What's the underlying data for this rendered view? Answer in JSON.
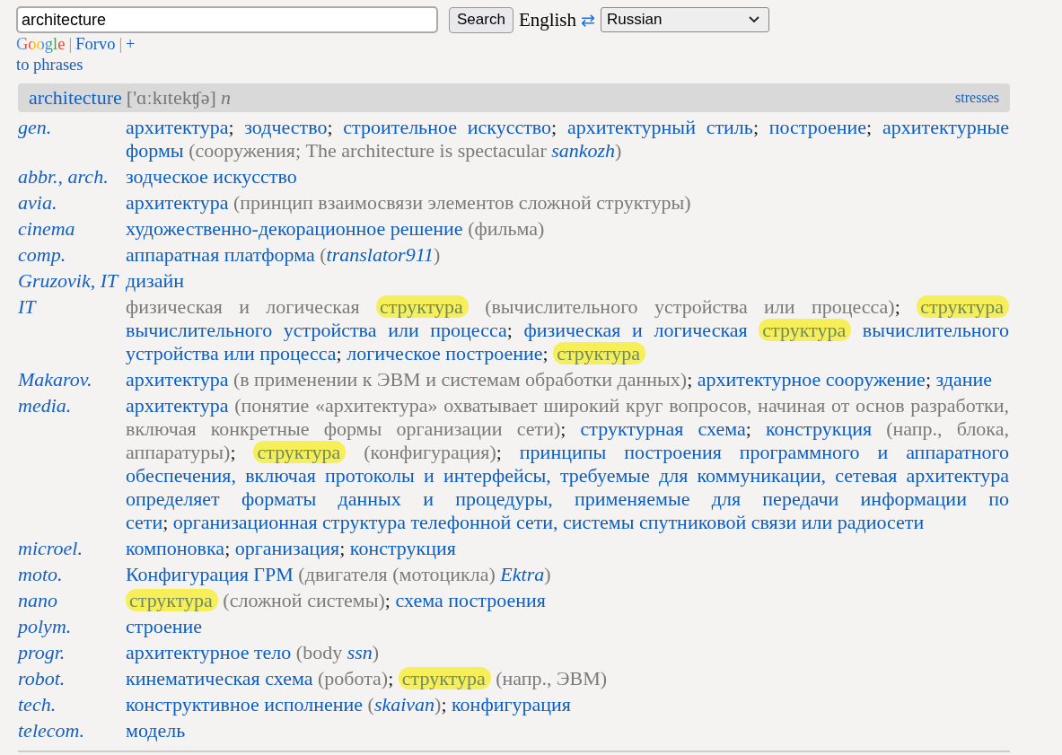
{
  "search": {
    "value": "architecture"
  },
  "search_button": "Search",
  "source_language": "English",
  "swap_icon": "⇄",
  "target_language": "Russian",
  "links": [
    {
      "kind": "google",
      "text": "Google"
    },
    {
      "kind": "sep",
      "text": "|"
    },
    {
      "kind": "link",
      "text": "Forvo"
    },
    {
      "kind": "sep",
      "text": "|"
    },
    {
      "kind": "link",
      "text": "+"
    }
  ],
  "phrases_link": "to phrases",
  "entry": {
    "word": "architecture",
    "transcription": "['ɑːkɪtekʧə]",
    "pos": "n",
    "stresses": "stresses"
  },
  "rows": [
    {
      "subject": "gen.",
      "parts": [
        {
          "kind": "term",
          "text": "архитектура"
        },
        {
          "kind": "punct",
          "text": "; "
        },
        {
          "kind": "term",
          "text": "зодчество"
        },
        {
          "kind": "punct",
          "text": "; "
        },
        {
          "kind": "term",
          "text": "строительное искусство"
        },
        {
          "kind": "punct",
          "text": "; "
        },
        {
          "kind": "term",
          "text": "архитектурный стиль"
        },
        {
          "kind": "punct",
          "text": "; "
        },
        {
          "kind": "term",
          "text": "построение"
        },
        {
          "kind": "punct",
          "text": "; "
        },
        {
          "kind": "term",
          "text": "архитектурные формы"
        },
        {
          "kind": "note",
          "text": " (сооружения; The architecture is spectacular "
        },
        {
          "kind": "author",
          "text": "sankozh"
        },
        {
          "kind": "note",
          "text": ")"
        }
      ]
    },
    {
      "subject": "abbr., arch.",
      "parts": [
        {
          "kind": "term",
          "text": "зодческое искусство"
        }
      ]
    },
    {
      "subject": "avia.",
      "parts": [
        {
          "kind": "term",
          "text": "архитектура"
        },
        {
          "kind": "note",
          "text": " (принцип взаимосвязи элементов сложной структуры)"
        }
      ]
    },
    {
      "subject": "cinema",
      "parts": [
        {
          "kind": "term",
          "text": "художественно-декорационное решение"
        },
        {
          "kind": "note",
          "text": " (фильма)"
        }
      ]
    },
    {
      "subject": "comp.",
      "parts": [
        {
          "kind": "term",
          "text": "аппаратная платформа"
        },
        {
          "kind": "note",
          "text": " ("
        },
        {
          "kind": "author",
          "text": "translator911"
        },
        {
          "kind": "note",
          "text": ")"
        }
      ]
    },
    {
      "subject": "Gruzovik, IT",
      "parts": [
        {
          "kind": "term",
          "text": "дизайн"
        }
      ]
    },
    {
      "subject": "IT",
      "parts": [
        {
          "kind": "note",
          "text": "физическая и логическая "
        },
        {
          "kind": "match",
          "text": "структура"
        },
        {
          "kind": "note",
          "text": " (вычислительного устройства или процесса)"
        },
        {
          "kind": "punct",
          "text": "; "
        },
        {
          "kind": "match",
          "text": "структура"
        },
        {
          "kind": "term",
          "text": " вычислительного устройства или процесса"
        },
        {
          "kind": "punct",
          "text": "; "
        },
        {
          "kind": "term",
          "text": "физическая и логическая "
        },
        {
          "kind": "match",
          "text": "структура"
        },
        {
          "kind": "term",
          "text": " вычислительного устройства или процесса"
        },
        {
          "kind": "punct",
          "text": "; "
        },
        {
          "kind": "term",
          "text": "логическое построение"
        },
        {
          "kind": "punct",
          "text": "; "
        },
        {
          "kind": "match",
          "text": "структура"
        }
      ]
    },
    {
      "subject": "Makarov.",
      "parts": [
        {
          "kind": "term",
          "text": "архитектура"
        },
        {
          "kind": "note",
          "text": " (в применении к ЭВМ и системам обработки данных)"
        },
        {
          "kind": "punct",
          "text": "; "
        },
        {
          "kind": "term",
          "text": "архитектурное сооружение"
        },
        {
          "kind": "punct",
          "text": "; "
        },
        {
          "kind": "term",
          "text": "здание"
        }
      ]
    },
    {
      "subject": "media.",
      "parts": [
        {
          "kind": "term",
          "text": "архитектура"
        },
        {
          "kind": "note",
          "text": " (понятие «архитектура» охватывает широкий круг вопросов, начиная от основ разработки, включая конкретные формы организации сети)"
        },
        {
          "kind": "punct",
          "text": "; "
        },
        {
          "kind": "term",
          "text": "структурная схема"
        },
        {
          "kind": "punct",
          "text": "; "
        },
        {
          "kind": "term",
          "text": "конструкция"
        },
        {
          "kind": "note",
          "text": " (напр., блока, аппаратуры)"
        },
        {
          "kind": "punct",
          "text": "; "
        },
        {
          "kind": "match",
          "text": "структура"
        },
        {
          "kind": "note",
          "text": " (конфигурация)"
        },
        {
          "kind": "punct",
          "text": "; "
        },
        {
          "kind": "term",
          "text": "принципы построения программного и аппаратного обеспечения, включая протоколы и интерфейсы, требуемые для коммуникации, сетевая архитектура определяет форматы данных и процедуры, применяемые для передачи информации по сети"
        },
        {
          "kind": "punct",
          "text": "; "
        },
        {
          "kind": "term",
          "text": "организационная структура телефонной сети, системы спутниковой связи или радиосети"
        }
      ]
    },
    {
      "subject": "microel.",
      "parts": [
        {
          "kind": "term",
          "text": "компоновка"
        },
        {
          "kind": "punct",
          "text": "; "
        },
        {
          "kind": "term",
          "text": "организация"
        },
        {
          "kind": "punct",
          "text": "; "
        },
        {
          "kind": "term",
          "text": "конструкция"
        }
      ]
    },
    {
      "subject": "moto.",
      "parts": [
        {
          "kind": "term",
          "text": "Конфигурация ГРМ"
        },
        {
          "kind": "note",
          "text": " (двигателя (мотоцикла) "
        },
        {
          "kind": "author",
          "text": "Ektra"
        },
        {
          "kind": "note",
          "text": ")"
        }
      ]
    },
    {
      "subject": "nano",
      "parts": [
        {
          "kind": "match",
          "text": "структура"
        },
        {
          "kind": "note",
          "text": " (сложной системы)"
        },
        {
          "kind": "punct",
          "text": "; "
        },
        {
          "kind": "term",
          "text": "схема построения"
        }
      ]
    },
    {
      "subject": "polym.",
      "parts": [
        {
          "kind": "term",
          "text": "строение"
        }
      ]
    },
    {
      "subject": "progr.",
      "parts": [
        {
          "kind": "term",
          "text": "архитектурное тело"
        },
        {
          "kind": "note",
          "text": " (body "
        },
        {
          "kind": "author",
          "text": "ssn"
        },
        {
          "kind": "note",
          "text": ")"
        }
      ]
    },
    {
      "subject": "robot.",
      "parts": [
        {
          "kind": "term",
          "text": "кинематическая схема"
        },
        {
          "kind": "note",
          "text": " (робота)"
        },
        {
          "kind": "punct",
          "text": "; "
        },
        {
          "kind": "match",
          "text": "структура"
        },
        {
          "kind": "note",
          "text": " (напр., ЭВМ)"
        }
      ]
    },
    {
      "subject": "tech.",
      "parts": [
        {
          "kind": "term",
          "text": "конструктивное исполнение"
        },
        {
          "kind": "note",
          "text": " ("
        },
        {
          "kind": "author",
          "text": "skaivan"
        },
        {
          "kind": "note",
          "text": ")"
        },
        {
          "kind": "punct",
          "text": "; "
        },
        {
          "kind": "term",
          "text": "конфигурация"
        }
      ]
    },
    {
      "subject": "telecom.",
      "parts": [
        {
          "kind": "term",
          "text": "модель"
        }
      ]
    }
  ]
}
